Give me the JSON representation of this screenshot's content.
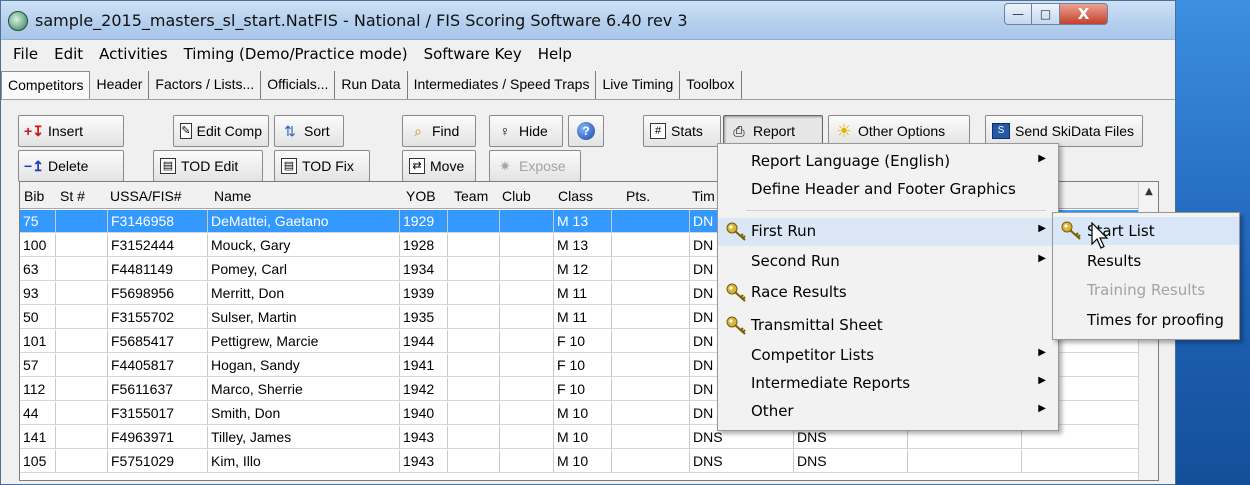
{
  "window": {
    "title": "sample_2015_masters_sl_start.NatFIS - National / FIS Scoring Software 6.40 rev 3",
    "controls": {
      "minimize": "—",
      "maximize": "□",
      "close": "X"
    }
  },
  "menubar": [
    "File",
    "Edit",
    "Activities",
    "Timing (Demo/Practice mode)",
    "Software Key",
    "Help"
  ],
  "tabs": [
    "Competitors",
    "Header",
    "Factors / Lists...",
    "Officials...",
    "Run Data",
    "Intermediates / Speed Traps",
    "Live Timing",
    "Toolbox"
  ],
  "toolbar": {
    "insert": "Insert",
    "edit_comp": "Edit Comp",
    "sort": "Sort",
    "find": "Find",
    "hide": "Hide",
    "stats": "Stats",
    "report": "Report",
    "other_options": "Other Options",
    "send_skidata": "Send SkiData Files",
    "delete": "Delete",
    "tod_edit": "TOD Edit",
    "tod_fix": "TOD Fix",
    "move": "Move",
    "expose": "Expose"
  },
  "grid": {
    "columns": [
      "Bib",
      "St #",
      "USSA/FIS#",
      "Name",
      "YOB",
      "Team",
      "Club",
      "Class",
      "Pts.",
      "Tim"
    ],
    "rows": [
      {
        "bib": "75",
        "st": "",
        "id": "F3146958",
        "name": "DeMattei, Gaetano",
        "yob": "1929",
        "team": "",
        "club": "",
        "cls": "M 13",
        "pts": "",
        "t1": "DN",
        "t2": ""
      },
      {
        "bib": "100",
        "st": "",
        "id": "F3152444",
        "name": "Mouck, Gary",
        "yob": "1928",
        "team": "",
        "club": "",
        "cls": "M 13",
        "pts": "",
        "t1": "DN",
        "t2": ""
      },
      {
        "bib": "63",
        "st": "",
        "id": "F4481149",
        "name": "Pomey, Carl",
        "yob": "1934",
        "team": "",
        "club": "",
        "cls": "M 12",
        "pts": "",
        "t1": "DN",
        "t2": ""
      },
      {
        "bib": "93",
        "st": "",
        "id": "F5698956",
        "name": "Merritt, Don",
        "yob": "1939",
        "team": "",
        "club": "",
        "cls": "M 11",
        "pts": "",
        "t1": "DN",
        "t2": ""
      },
      {
        "bib": "50",
        "st": "",
        "id": "F3155702",
        "name": "Sulser, Martin",
        "yob": "1935",
        "team": "",
        "club": "",
        "cls": "M 11",
        "pts": "",
        "t1": "DN",
        "t2": ""
      },
      {
        "bib": "101",
        "st": "",
        "id": "F5685417",
        "name": "Pettigrew, Marcie",
        "yob": "1944",
        "team": "",
        "club": "",
        "cls": "F 10",
        "pts": "",
        "t1": "DN",
        "t2": ""
      },
      {
        "bib": "57",
        "st": "",
        "id": "F4405817",
        "name": "Hogan, Sandy",
        "yob": "1941",
        "team": "",
        "club": "",
        "cls": "F 10",
        "pts": "",
        "t1": "DN",
        "t2": ""
      },
      {
        "bib": "112",
        "st": "",
        "id": "F5611637",
        "name": "Marco, Sherrie",
        "yob": "1942",
        "team": "",
        "club": "",
        "cls": "F 10",
        "pts": "",
        "t1": "DN",
        "t2": ""
      },
      {
        "bib": "44",
        "st": "",
        "id": "F3155017",
        "name": "Smith, Don",
        "yob": "1940",
        "team": "",
        "club": "",
        "cls": "M 10",
        "pts": "",
        "t1": "DN",
        "t2": ""
      },
      {
        "bib": "141",
        "st": "",
        "id": "F4963971",
        "name": "Tilley, James",
        "yob": "1943",
        "team": "",
        "club": "",
        "cls": "M 10",
        "pts": "",
        "t1": "DNS",
        "t2": "DNS"
      },
      {
        "bib": "105",
        "st": "",
        "id": "F5751029",
        "name": "Kim, Illo",
        "yob": "1943",
        "team": "",
        "club": "",
        "cls": "M 10",
        "pts": "",
        "t1": "DNS",
        "t2": "DNS"
      }
    ]
  },
  "report_menu": {
    "items": [
      {
        "label": "Report Language (English)",
        "submenu": true,
        "key": false
      },
      {
        "label": "Define Header and Footer Graphics",
        "submenu": false,
        "key": false
      },
      {
        "label": "First Run",
        "submenu": true,
        "key": true
      },
      {
        "label": "Second Run",
        "submenu": true,
        "key": false
      },
      {
        "label": "Race Results",
        "submenu": false,
        "key": true
      },
      {
        "label": "Transmittal Sheet",
        "submenu": false,
        "key": true
      },
      {
        "label": "Competitor Lists",
        "submenu": true,
        "key": false
      },
      {
        "label": "Intermediate Reports",
        "submenu": true,
        "key": false
      },
      {
        "label": "Other",
        "submenu": true,
        "key": false
      }
    ],
    "arrow": "▶"
  },
  "first_run_submenu": {
    "items": [
      {
        "label": "Start List",
        "disabled": false
      },
      {
        "label": "Results",
        "disabled": false
      },
      {
        "label": "Training Results",
        "disabled": true
      },
      {
        "label": "Times for proofing",
        "disabled": false
      }
    ]
  },
  "colors": {
    "selection": "#3399ff",
    "menu_hover": "#dbe7f5",
    "key_gold": "#d8b73c"
  }
}
